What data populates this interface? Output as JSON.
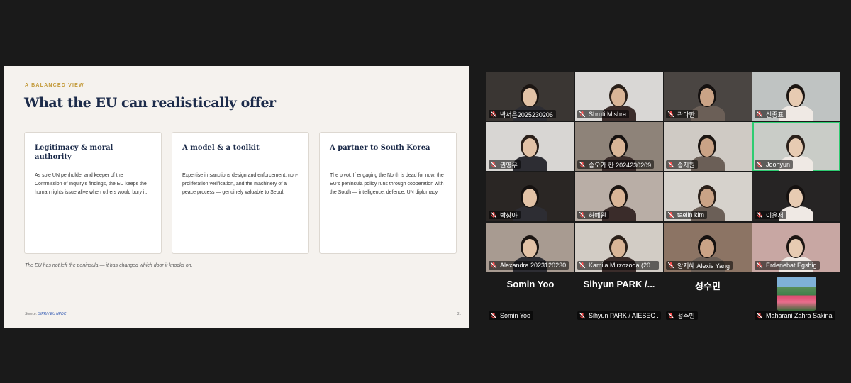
{
  "slide": {
    "eyebrow": "A BALANCED VIEW",
    "title": "What the EU can realistically offer",
    "cards": [
      {
        "title": "Legitimacy & moral authority",
        "body": "As sole UN penholder and keeper of the Commission of Inquiry's findings, the EU keeps the human rights issue alive when others would bury it."
      },
      {
        "title": "A model & a toolkit",
        "body": "Expertise in sanctions design and enforcement, non-proliferation verification, and the machinery of a peace process — genuinely valuable to Seoul."
      },
      {
        "title": "A partner to South Korea",
        "body": "The pivot. If engaging the North is dead for now, the EU's peninsula policy runs through cooperation with the South — intelligence, defence, UN diplomacy."
      }
    ],
    "tagline": "The EU has not left the peninsula — it has changed which door it knocks on.",
    "source_label": "Source:",
    "source_link": "SIPRI / EU NPDC",
    "page_number": "31"
  },
  "gallery": {
    "video_tiles": [
      {
        "name": "박서은2025230206",
        "bg": "#3a3633"
      },
      {
        "name": "Shruti Mishra",
        "bg": "#d9d7d5"
      },
      {
        "name": "곽다한",
        "bg": "#4a4542"
      },
      {
        "name": "신종표",
        "bg": "#bfc3c2"
      },
      {
        "name": "권영우",
        "bg": "#d8d6d3"
      },
      {
        "name": "송오가 칸 2024230209",
        "bg": "#8e8379"
      },
      {
        "name": "송지원",
        "bg": "#cfcac4"
      },
      {
        "name": "Joohyun",
        "bg": "#c9ccc7",
        "active": true
      },
      {
        "name": "박상아",
        "bg": "#2a2624"
      },
      {
        "name": "허예원",
        "bg": "#b9aea6"
      },
      {
        "name": "taelin kim",
        "bg": "#d6d2cc"
      },
      {
        "name": "이윤서",
        "bg": "#262424"
      },
      {
        "name": "Alexandra 2023120230",
        "bg": "#a89b91"
      },
      {
        "name": "Kamila Mirzozoda (20...",
        "bg": "#d2ccc5"
      },
      {
        "name": "양지혜 Alexis Yang",
        "bg": "#8c7464"
      },
      {
        "name": "Erdenebat Egshig",
        "bg": "#c8a7a3"
      }
    ],
    "no_video_tiles": [
      {
        "display": "Somin Yoo",
        "name": "Somin Yoo"
      },
      {
        "display": "Sihyun  PARK /...",
        "name": "Sihyun PARK / AIESEC ..."
      },
      {
        "display": "성수민",
        "name": "성수민"
      },
      {
        "display": "",
        "name": "Maharani Zahra Sakina"
      }
    ]
  },
  "colors": {
    "accent_gold": "#c39a3a",
    "title_navy": "#1c2b4a",
    "active_speaker": "#2ecc71",
    "muted_red": "#e03b3b"
  },
  "icons": {
    "muted": "mic-muted-icon"
  }
}
